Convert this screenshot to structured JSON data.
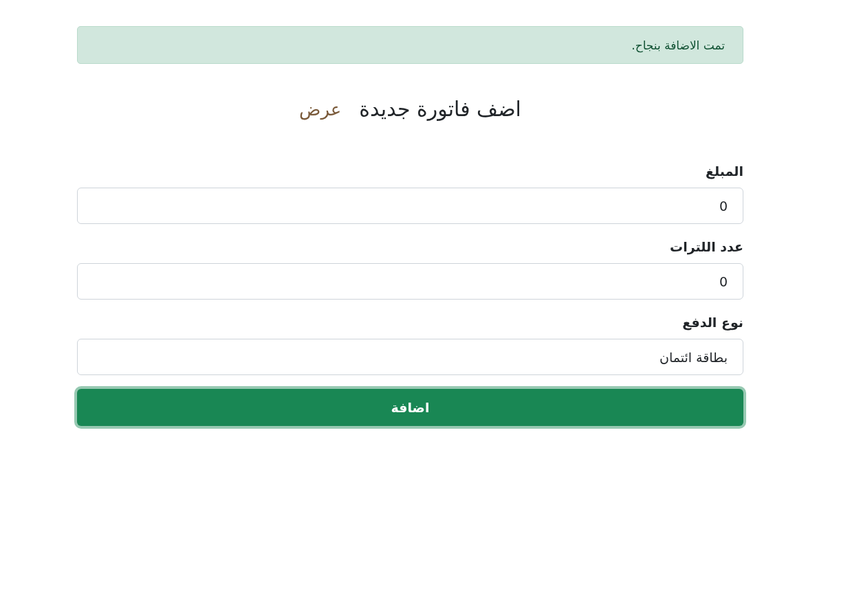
{
  "alert": {
    "text": "تمت الاضافة بنجاح."
  },
  "heading": {
    "title": "اضف فاتورة جديدة",
    "link": "عرض"
  },
  "fields": [
    {
      "label": "المبلغ",
      "value": "0"
    },
    {
      "label": "عدد اللترات",
      "value": "0"
    },
    {
      "label": "نوع الدفع",
      "value": "بطاقة ائتمان"
    }
  ],
  "submit": {
    "label": "اضافة",
    "focused": true
  }
}
